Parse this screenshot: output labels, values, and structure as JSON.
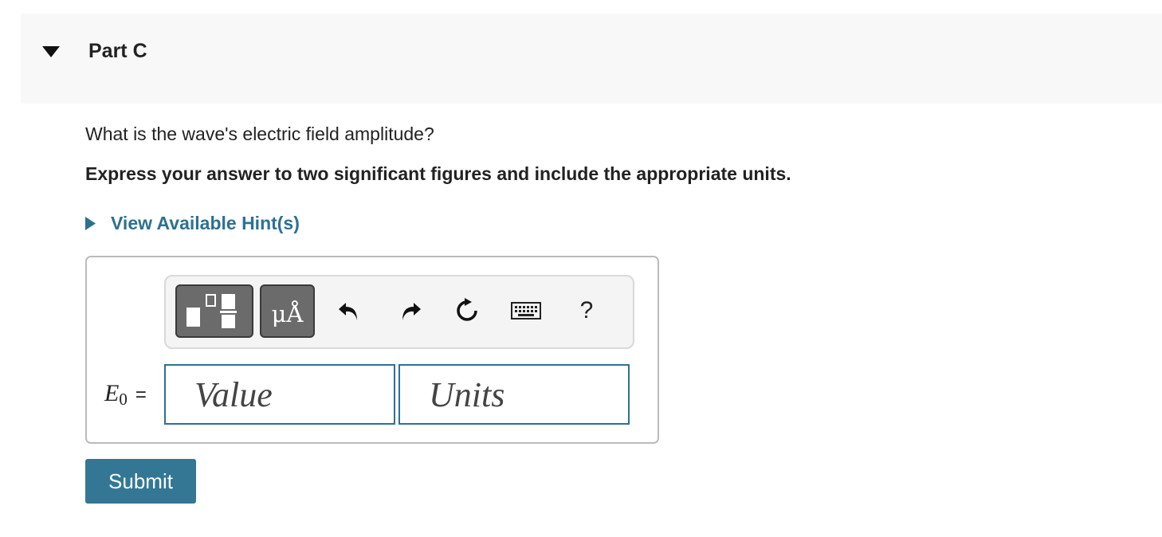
{
  "part": {
    "title": "Part C"
  },
  "question": {
    "text": "What is the wave's electric field amplitude?",
    "instruction": "Express your answer to two significant figures and include the appropriate units."
  },
  "hint": {
    "label": "View Available Hint(s)"
  },
  "toolbar": {
    "templates_icon": "templates-icon",
    "units_label": "μÅ",
    "undo_icon": "undo-icon",
    "redo_icon": "redo-icon",
    "reset_icon": "reset-icon",
    "keyboard_icon": "keyboard-icon",
    "help_label": "?"
  },
  "answer": {
    "variable_symbol": "E",
    "variable_subscript": "0",
    "equals": "=",
    "value_placeholder": "Value",
    "units_placeholder": "Units"
  },
  "submit": {
    "label": "Submit"
  },
  "colors": {
    "accent": "#2d7191",
    "button": "#337795",
    "toolbar_button": "#6b6b6b",
    "header_bg": "#f8f8f8"
  }
}
